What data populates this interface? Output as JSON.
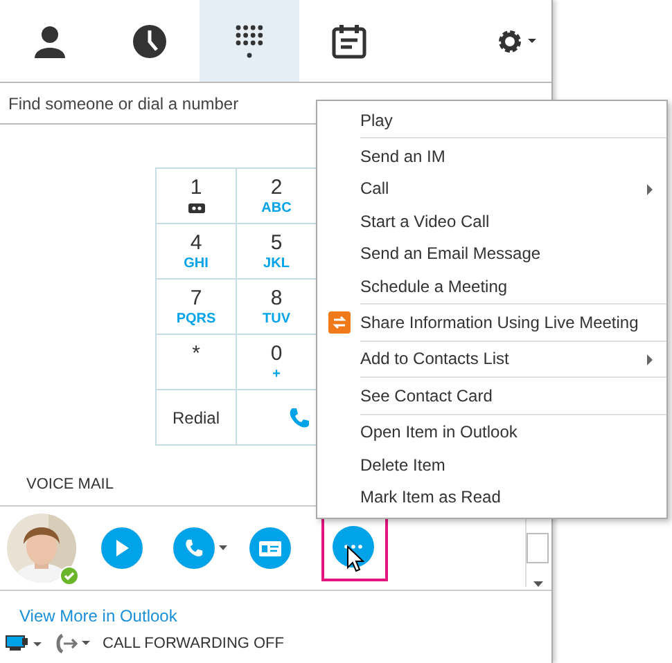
{
  "tabs": [
    {
      "kind": "contacts",
      "selected": false
    },
    {
      "kind": "history",
      "selected": false
    },
    {
      "kind": "dialpad",
      "selected": true
    },
    {
      "kind": "meetings",
      "selected": false
    }
  ],
  "search": {
    "placeholder": "Find someone or dial a number"
  },
  "dialpad": {
    "keys": [
      {
        "digit": "1",
        "kind": "voicemail"
      },
      {
        "digit": "2",
        "sub": "ABC",
        "kind": "letters"
      },
      {
        "digit": "4",
        "sub": "GHI",
        "kind": "letters"
      },
      {
        "digit": "5",
        "sub": "JKL",
        "kind": "letters"
      },
      {
        "digit": "7",
        "sub": "PQRS",
        "kind": "letters"
      },
      {
        "digit": "8",
        "sub": "TUV",
        "kind": "letters"
      },
      {
        "digit": "*",
        "kind": "letters"
      },
      {
        "digit": "0",
        "sub": "+",
        "kind": "letters"
      }
    ],
    "redial": "Redial"
  },
  "voice_mail": {
    "title": "VOICE MAIL",
    "link": "View More in Outlook"
  },
  "status_bar": {
    "call_forwarding": "CALL FORWARDING OFF"
  },
  "context_menu": [
    {
      "kind": "item",
      "label": "Play"
    },
    {
      "kind": "separator"
    },
    {
      "kind": "item",
      "label": "Send an IM"
    },
    {
      "kind": "submenu",
      "label": "Call"
    },
    {
      "kind": "item",
      "label": "Start a Video Call"
    },
    {
      "kind": "item",
      "label": "Send an Email Message"
    },
    {
      "kind": "item",
      "label": "Schedule a Meeting"
    },
    {
      "kind": "separator"
    },
    {
      "kind": "icon",
      "label": "Share Information Using Live Meeting"
    },
    {
      "kind": "separator"
    },
    {
      "kind": "submenu",
      "label": "Add to Contacts List"
    },
    {
      "kind": "separator"
    },
    {
      "kind": "item",
      "label": "See Contact Card"
    },
    {
      "kind": "separator"
    },
    {
      "kind": "item",
      "label": "Open Item in Outlook"
    },
    {
      "kind": "item",
      "label": "Delete Item"
    },
    {
      "kind": "item",
      "label": "Mark Item as Read"
    }
  ]
}
